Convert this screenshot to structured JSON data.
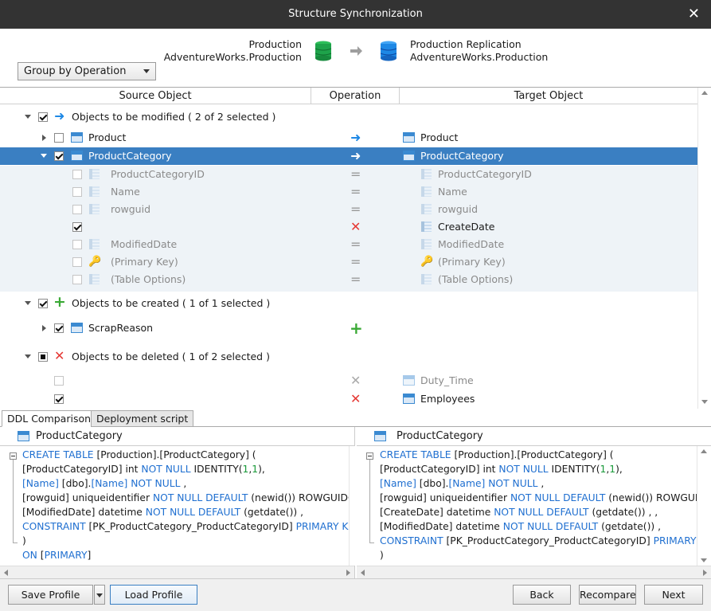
{
  "window": {
    "title": "Structure Synchronization"
  },
  "header": {
    "group_by": "Group by Operation",
    "source": {
      "line1": "Production",
      "line2": "AdventureWorks.Production"
    },
    "target": {
      "line1": "Production Replication",
      "line2": "AdventureWorks.Production"
    },
    "source_db_color": "#1ea34a",
    "target_db_color": "#1e88e5"
  },
  "columns": {
    "source": "Source Object",
    "operation": "Operation",
    "target": "Target Object"
  },
  "groups": {
    "modified": "Objects to be modified ( 2 of 2 selected )",
    "created": "Objects to be created ( 1 of 1 selected )",
    "deleted": "Objects to be deleted ( 1 of 2 selected )"
  },
  "rows": {
    "product_src": "Product",
    "product_tgt": "Product",
    "pc_src": "ProductCategory",
    "pc_tgt": "ProductCategory",
    "sub": [
      {
        "src": "ProductCategoryID",
        "tgt": "ProductCategoryID"
      },
      {
        "src": "Name",
        "tgt": "Name"
      },
      {
        "src": "rowguid",
        "tgt": "rowguid"
      },
      {
        "src": "",
        "tgt": "CreateDate"
      },
      {
        "src": "ModifiedDate",
        "tgt": "ModifiedDate"
      },
      {
        "src": "(Primary Key)",
        "tgt": "(Primary Key)"
      },
      {
        "src": "(Table Options)",
        "tgt": "(Table Options)"
      }
    ],
    "scrap": "ScrapReason",
    "duty": "Duty_Time",
    "employees": "Employees"
  },
  "tabs": {
    "ddl": "DDL Comparison",
    "deploy": "Deployment script"
  },
  "left_pane": {
    "title": "ProductCategory",
    "lines": {
      "l1a": "CREATE TABLE",
      "l1b": " [Production].[ProductCategory] (",
      "l2a": "[ProductCategoryID] int ",
      "l2b": "NOT NULL",
      "l2c": " IDENTITY(",
      "l2d": "1",
      "l2e": ",",
      "l2f": "1",
      "l2g": "),",
      "l3a": "[Name]",
      "l3b": " [dbo].",
      "l3c": "[Name]",
      "l3d": " NOT NULL",
      "l3e": " ,",
      "l4a": "[rowguid] uniqueidentifier ",
      "l4b": "NOT NULL DEFAULT",
      "l4c": " (newid()) ROWGUIDCOL",
      "l5a": "[ModifiedDate] datetime ",
      "l5b": "NOT NULL DEFAULT",
      "l5c": " (getdate()) ,",
      "l6a": "CONSTRAINT",
      "l6b": " [PK_ProductCategory_ProductCategoryID] ",
      "l6c": "PRIMARY KEY",
      "l6d": " (",
      "l7": ")",
      "l8a": "ON",
      "l8b": " [",
      "l8c": "PRIMARY",
      "l8d": "]"
    }
  },
  "right_pane": {
    "title": "ProductCategory",
    "lines": {
      "l1a": "CREATE TABLE",
      "l1b": " [Production].[ProductCategory] (",
      "l2a": "[ProductCategoryID] int ",
      "l2b": "NOT NULL",
      "l2c": " IDENTITY(",
      "l2d": "1",
      "l2e": ",",
      "l2f": "1",
      "l2g": "),",
      "l3a": "[Name]",
      "l3b": " [dbo].",
      "l3c": "[Name]",
      "l3d": " NOT NULL",
      "l3e": " ,",
      "l4a": "[rowguid] uniqueidentifier ",
      "l4b": "NOT NULL DEFAULT",
      "l4c": " (newid()) ROWGUIDCOL",
      "l5a": "[CreateDate] datetime ",
      "l5b": "NOT NULL DEFAULT",
      "l5c": " (getdate()) , ,",
      "l6a": "[ModifiedDate] datetime ",
      "l6b": "NOT NULL DEFAULT",
      "l6c": " (getdate()) ,",
      "l7a": "CONSTRAINT",
      "l7b": " [PK_ProductCategory_ProductCategoryID] ",
      "l7c": "PRIMARY KEY",
      "l8": ")"
    }
  },
  "footer": {
    "save_profile": "Save Profile",
    "load_profile": "Load Profile",
    "back": "Back",
    "recompare": "Recompare",
    "next": "Next"
  }
}
